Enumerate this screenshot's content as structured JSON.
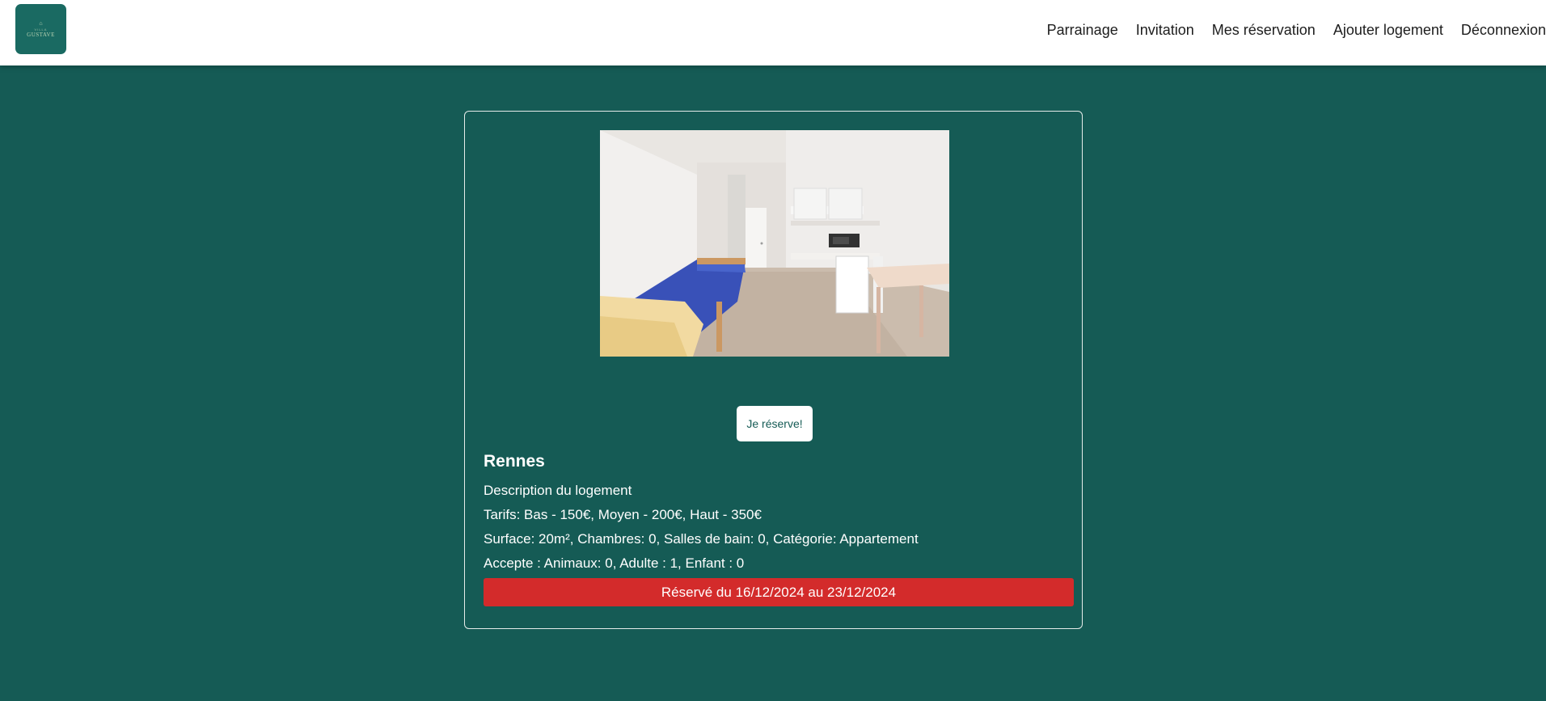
{
  "header": {
    "logo": {
      "icon": "logo-mark",
      "small_text": "VILLA",
      "word": "GUSTAVE",
      "color": "#1a6a62"
    },
    "nav": [
      {
        "label": "Parrainage"
      },
      {
        "label": "Invitation"
      },
      {
        "label": "Mes réservation"
      },
      {
        "label": "Ajouter logement"
      },
      {
        "label": "Déconnexion"
      }
    ]
  },
  "listing": {
    "reserve_label": "Je réserve!",
    "city": "Rennes",
    "description": "Description du logement",
    "tarifs": "Tarifs: Bas - 150€, Moyen - 200€, Haut - 350€",
    "surface": "Surface: 20m², Chambres: 0, Salles de bain: 0, Catégorie: Appartement",
    "accepte": "Accepte : Animaux: 0, Adulte : 1, Enfant : 0",
    "status": "Réservé du 16/12/2024 au 23/12/2024"
  },
  "colors": {
    "background": "#155b55",
    "status_red": "#d32b2b",
    "navbar": "#ffffff"
  }
}
